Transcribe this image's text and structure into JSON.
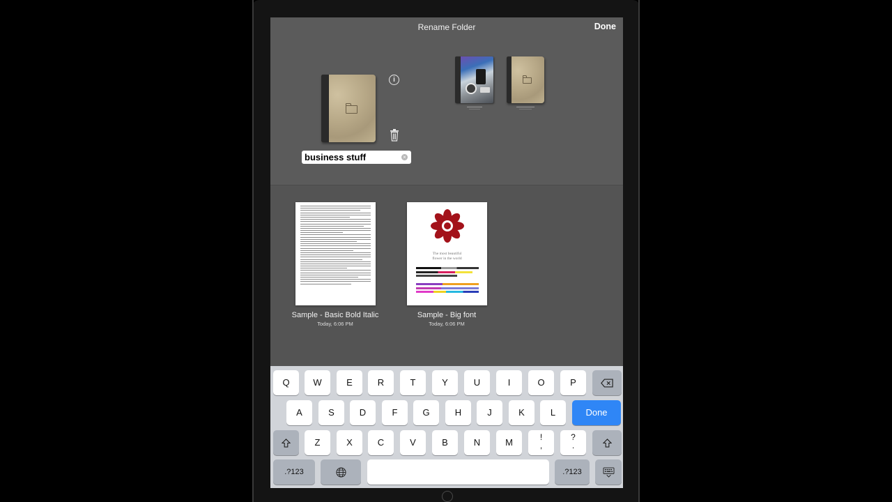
{
  "header": {
    "title": "Rename Folder",
    "done_label": "Done"
  },
  "folder_editor": {
    "name_value": "business stuff",
    "clear_symbol": "×",
    "info_symbol": "i",
    "icons": [
      "folder-icon",
      "info-icon",
      "trash-icon",
      "clear-icon"
    ]
  },
  "documents": [
    {
      "name": "Sample - Basic Bold Italic",
      "date": "Today, 6:06 PM"
    },
    {
      "name": "Sample - Big font",
      "date": "Today, 6:06 PM",
      "preview_lines": [
        "The most beautiful",
        "flower in the world"
      ]
    }
  ],
  "keyboard": {
    "row1": [
      "Q",
      "W",
      "E",
      "R",
      "T",
      "Y",
      "U",
      "I",
      "O",
      "P"
    ],
    "row2": [
      "A",
      "S",
      "D",
      "F",
      "G",
      "H",
      "J",
      "K",
      "L"
    ],
    "row3": [
      "Z",
      "X",
      "C",
      "V",
      "B",
      "N",
      "M",
      "!\n,",
      "?\n."
    ],
    "return_label": "Done",
    "numbers_label": ".?123",
    "icons": [
      "backspace-icon",
      "shift-icon",
      "globe-icon",
      "keyboard-dismiss-icon"
    ]
  },
  "colors": {
    "accent": "#2f86f6",
    "screen_bg": "#545454",
    "keyboard_bg": "#d1d4d9"
  }
}
